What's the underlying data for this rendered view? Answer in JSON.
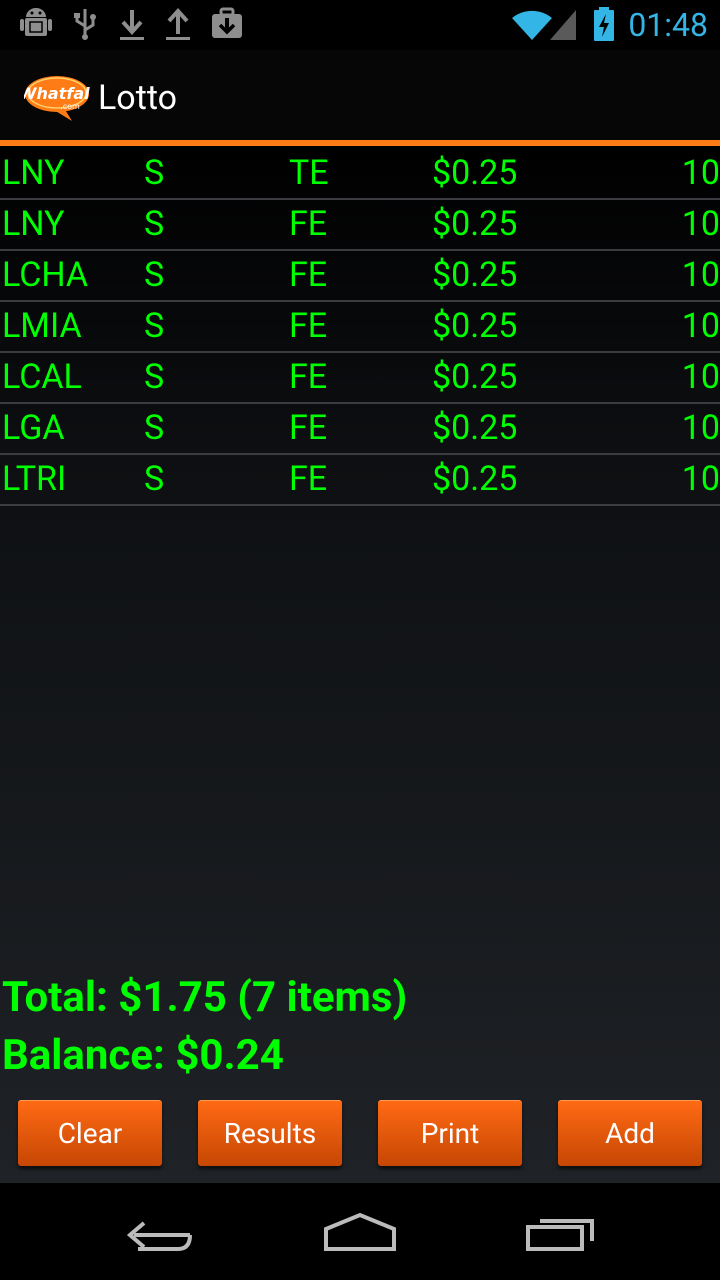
{
  "status_bar": {
    "time": "01:48",
    "icons": [
      "android-debug-icon",
      "usb-icon",
      "download-icon",
      "upload-icon",
      "download-box-icon",
      "wifi-icon",
      "signal-icon",
      "battery-charging-icon"
    ]
  },
  "app_bar": {
    "title": "Lotto",
    "logo_text": "Whatfall",
    "logo_subtext": ".com"
  },
  "tickets": [
    [
      "LNY",
      "S",
      "TE",
      "$0.25",
      "10"
    ],
    [
      "LNY",
      "S",
      "FE",
      "$0.25",
      "10"
    ],
    [
      "LCHA",
      "S",
      "FE",
      "$0.25",
      "10"
    ],
    [
      "LMIA",
      "S",
      "FE",
      "$0.25",
      "10"
    ],
    [
      "LCAL",
      "S",
      "FE",
      "$0.25",
      "10"
    ],
    [
      "LGA",
      "S",
      "FE",
      "$0.25",
      "10"
    ],
    [
      "LTRI",
      "S",
      "FE",
      "$0.25",
      "10"
    ]
  ],
  "summary": {
    "total": "Total: $1.75 (7 items)",
    "balance": "Balance: $0.24"
  },
  "buttons": {
    "clear": "Clear",
    "results": "Results",
    "print": "Print",
    "add": "Add"
  },
  "colors": {
    "accent": "#ff7b15",
    "text_green": "#00ff00",
    "clock_blue": "#33b5e5"
  }
}
